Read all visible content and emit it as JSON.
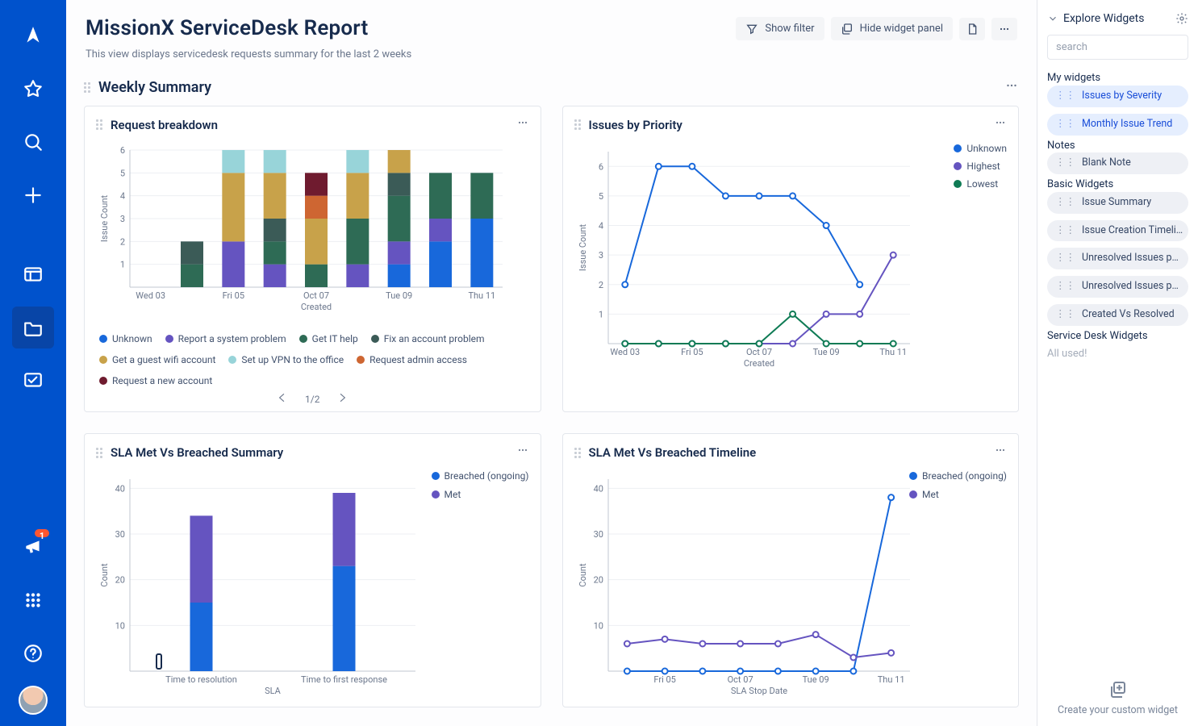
{
  "sidebar": {
    "icons": [
      "logo",
      "star",
      "search",
      "plus",
      "panel",
      "folder",
      "kanban"
    ],
    "selected": "folder",
    "notif_count": "1"
  },
  "header": {
    "title": "MissionX ServiceDesk Report",
    "subtitle": "This view displays servicedesk requests summary for the last 2 weeks",
    "show_filter": "Show filter",
    "hide_widget": "Hide widget panel"
  },
  "section": {
    "title": "Weekly Summary"
  },
  "cards": {
    "breakdown": {
      "title": "Request breakdown",
      "pager": "1/2"
    },
    "priority": {
      "title": "Issues by Priority"
    },
    "sla_sum": {
      "title": "SLA Met Vs Breached Summary"
    },
    "sla_tl": {
      "title": "SLA Met Vs Breached Timeline"
    }
  },
  "legend_colors": {
    "Unknown": "#1868DB",
    "Report a system problem": "#6554C0",
    "Get IT help": "#2E6B55",
    "Fix an account problem": "#3B5B57",
    "Get a guest wifi account": "#C8A24A",
    "Set up VPN to the office": "#98D4D9",
    "Request admin access": "#CE6632",
    "Request a new account": "#6F1B2F",
    "Highest": "#6554C0",
    "Lowest": "#0F7B55",
    "Breached (ongoing)": "#1868DB",
    "Met": "#6554C0"
  },
  "right": {
    "title": "Explore Widgets",
    "search_ph": "search",
    "groups": [
      {
        "name": "My widgets",
        "style": "blue",
        "items": [
          "Issues by Severity",
          "Monthly Issue Trend"
        ]
      },
      {
        "name": "Notes",
        "style": "gray",
        "items": [
          "Blank Note"
        ]
      },
      {
        "name": "Basic Widgets",
        "style": "gray",
        "items": [
          "Issue Summary",
          "Issue Creation Timeli…",
          "Unresolved Issues p…",
          "Unresolved Issues p…",
          "Created Vs Resolved"
        ]
      },
      {
        "name": "Service Desk Widgets",
        "style": "mute",
        "items": []
      }
    ],
    "all_used": "All used!",
    "create": "Create your custom widget"
  },
  "chart_data": [
    {
      "id": "breakdown",
      "type": "bar",
      "stacked": true,
      "xlabel": "Created",
      "ylabel": "Issue Count",
      "ylim": [
        0,
        6
      ],
      "categories": [
        "Wed 03",
        "",
        "Fri 05",
        "",
        "Oct 07",
        "",
        "Tue 09",
        "",
        "Thu 11"
      ],
      "series": [
        {
          "name": "Unknown",
          "color": "#1868DB",
          "values": [
            0,
            0,
            0,
            0,
            0,
            0,
            1,
            2,
            3
          ]
        },
        {
          "name": "Report a system problem",
          "color": "#6554C0",
          "values": [
            0,
            0,
            2,
            1,
            0,
            1,
            1,
            1,
            0
          ]
        },
        {
          "name": "Get IT help",
          "color": "#2E6B55",
          "values": [
            0,
            1,
            0,
            1,
            1,
            2,
            2,
            2,
            2
          ]
        },
        {
          "name": "Fix an account problem",
          "color": "#3B5B57",
          "values": [
            0,
            1,
            0,
            1,
            0,
            0,
            1,
            0,
            0
          ]
        },
        {
          "name": "Get a guest wifi account",
          "color": "#C8A24A",
          "values": [
            0,
            0,
            3,
            2,
            2,
            2,
            1,
            0,
            0
          ]
        },
        {
          "name": "Set up VPN to the office",
          "color": "#98D4D9",
          "values": [
            0,
            0,
            1,
            1,
            0,
            1,
            0,
            0,
            0
          ]
        },
        {
          "name": "Request admin access",
          "color": "#CE6632",
          "values": [
            0,
            0,
            0,
            0,
            1,
            0,
            0,
            0,
            0
          ]
        },
        {
          "name": "Request a new account",
          "color": "#6F1B2F",
          "values": [
            0,
            0,
            0,
            0,
            1,
            0,
            0,
            0,
            0
          ]
        }
      ]
    },
    {
      "id": "priority",
      "type": "line",
      "xlabel": "Created",
      "ylabel": "Issue Count",
      "ylim": [
        0,
        6.5
      ],
      "categories": [
        "Wed 03",
        "",
        "Fri 05",
        "",
        "Oct 07",
        "",
        "Tue 09",
        "",
        "Thu 11"
      ],
      "series": [
        {
          "name": "Unknown",
          "color": "#1868DB",
          "values": [
            2,
            6,
            6,
            5,
            5,
            5,
            4,
            2,
            null
          ]
        },
        {
          "name": "Highest",
          "color": "#6554C0",
          "values": [
            0,
            0,
            0,
            0,
            0,
            0,
            1,
            1,
            3
          ]
        },
        {
          "name": "Lowest",
          "color": "#0F7B55",
          "values": [
            0,
            0,
            0,
            0,
            0,
            1,
            0,
            0,
            0
          ]
        }
      ]
    },
    {
      "id": "sla_sum",
      "type": "bar",
      "stacked": true,
      "xlabel": "SLA",
      "ylabel": "Count",
      "ylim": [
        0,
        42
      ],
      "categories": [
        "Time to resolution",
        "Time to first response"
      ],
      "series": [
        {
          "name": "Breached (ongoing)",
          "color": "#1868DB",
          "values": [
            15,
            23
          ]
        },
        {
          "name": "Met",
          "color": "#6554C0",
          "values": [
            19,
            16
          ]
        }
      ]
    },
    {
      "id": "sla_tl",
      "type": "line",
      "xlabel": "SLA Stop Date",
      "ylabel": "Count",
      "ylim": [
        0,
        42
      ],
      "categories": [
        "",
        "Fri 05",
        "",
        "Oct 07",
        "",
        "Tue 09",
        "",
        "Thu 11"
      ],
      "series": [
        {
          "name": "Breached (ongoing)",
          "color": "#1868DB",
          "values": [
            0,
            0,
            0,
            0,
            0,
            0,
            0,
            38
          ]
        },
        {
          "name": "Met",
          "color": "#6554C0",
          "values": [
            6,
            7,
            6,
            6,
            6,
            8,
            3,
            4
          ]
        }
      ]
    }
  ]
}
